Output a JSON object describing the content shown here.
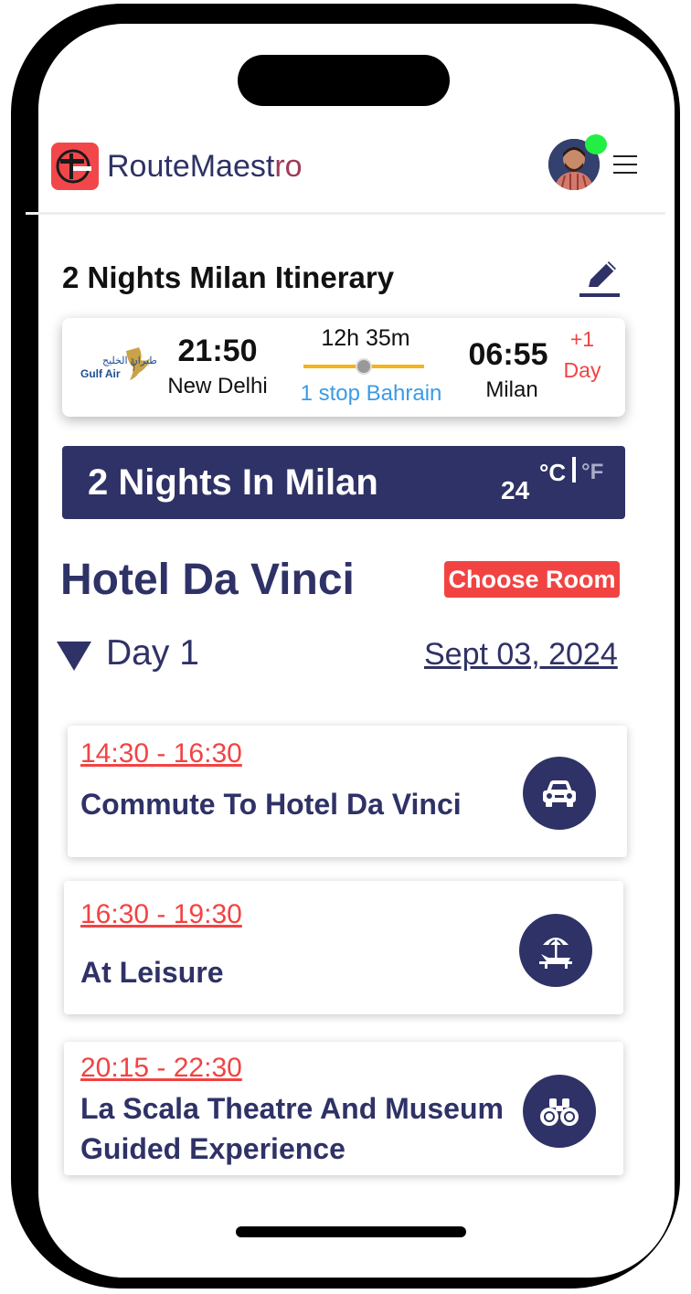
{
  "app": {
    "brand_part1": "RouteMaest",
    "brand_part2": "ro"
  },
  "itinerary": {
    "title": "2 Nights Milan Itinerary"
  },
  "flight": {
    "airline": "Gulf Air",
    "airline_arabic": "طيران الخليج",
    "departure_time": "21:50",
    "departure_city": "New Delhi",
    "duration": "12h 35m",
    "stops": "1 stop Bahrain",
    "arrival_time": "06:55",
    "arrival_city": "Milan",
    "day_offset_1": "+1",
    "day_offset_2": "Day"
  },
  "stay": {
    "banner_title": "2 Nights In Milan",
    "temperature": "24",
    "unit_c": "°C",
    "unit_f": "°F",
    "hotel_name": "Hotel Da Vinci",
    "choose_room_label": "Choose Room"
  },
  "day": {
    "label": "Day 1",
    "date": "Sept 03, 2024"
  },
  "activities": [
    {
      "time": "14:30 - 16:30",
      "title": "Commute To Hotel Da Vinci",
      "icon": "car-icon"
    },
    {
      "time": "16:30 - 19:30",
      "title": "At Leisure",
      "icon": "beach-chair-icon"
    },
    {
      "time": "20:15 - 22:30",
      "title": "La Scala Theatre And Museum Guided Experience",
      "icon": "binoculars-icon"
    }
  ],
  "colors": {
    "primary": "#2f3266",
    "accent": "#f24343",
    "link": "#3a9be6",
    "route_line": "#f3b41c",
    "online": "#22ee44"
  }
}
